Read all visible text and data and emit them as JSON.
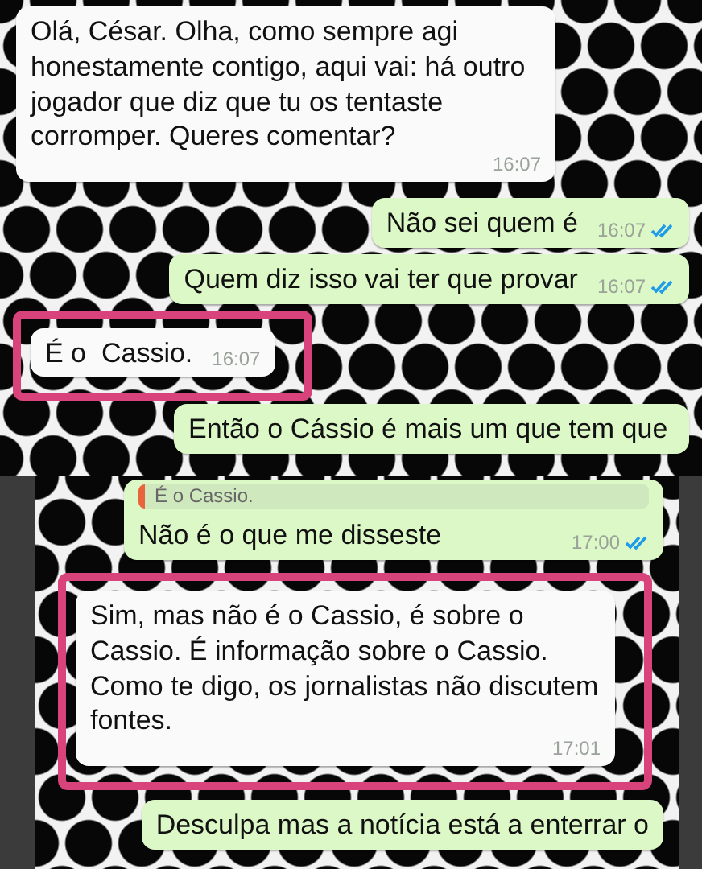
{
  "panels": [
    {
      "messages": [
        {
          "kind": "incoming",
          "text": "Olá, César. Olha, como sempre agi honestamente contigo, aqui vai: há outro jogador que diz que tu os tentaste corromper. Queres comentar?",
          "time": "16:07",
          "highlighted": false
        },
        {
          "kind": "outgoing",
          "text": "Não sei quem é",
          "time": "16:07",
          "read": true,
          "highlighted": false
        },
        {
          "kind": "outgoing",
          "text": "Quem diz isso vai ter que provar",
          "time": "16:07",
          "read": true,
          "highlighted": false
        },
        {
          "kind": "incoming",
          "text": "É o  Cassio.",
          "time": "16:07",
          "highlighted": true
        },
        {
          "kind": "outgoing",
          "text": "Então o Cássio é mais um que tem que",
          "highlighted": false
        }
      ]
    },
    {
      "messages": [
        {
          "kind": "outgoing",
          "quote": "É o Cassio.",
          "text": "Não é o que me disseste",
          "time": "17:00",
          "read": true,
          "highlighted": false
        },
        {
          "kind": "incoming",
          "text": "Sim, mas não é o Cassio, é sobre o Cassio. É informação sobre o Cassio. Como te digo, os jornalistas não discutem fontes.",
          "time": "17:01",
          "highlighted": true
        },
        {
          "kind": "outgoing",
          "text": "Desculpa mas a notícia está a enterrar o",
          "highlighted": false
        }
      ]
    }
  ]
}
